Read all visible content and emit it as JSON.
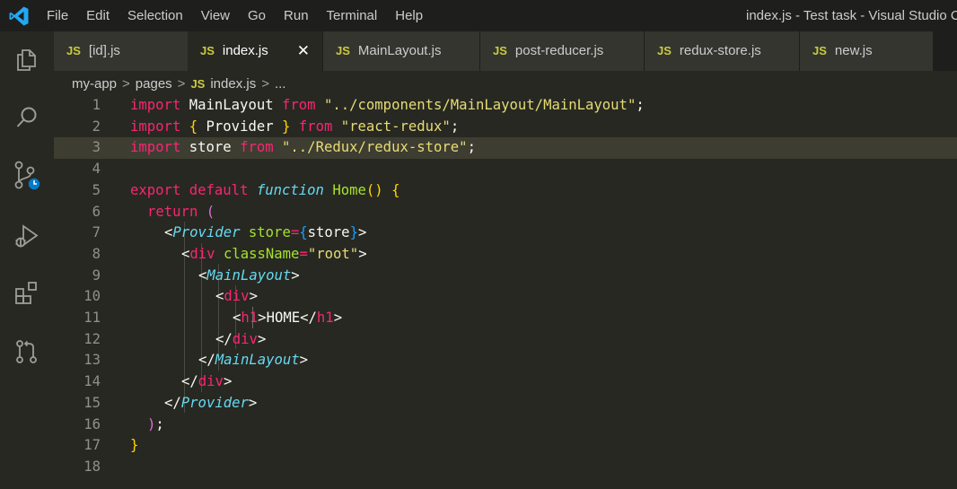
{
  "menu": [
    "File",
    "Edit",
    "Selection",
    "View",
    "Go",
    "Run",
    "Terminal",
    "Help"
  ],
  "window_title": "index.js - Test task - Visual Studio Co",
  "tabs": [
    {
      "icon": "JS",
      "label": "[id].js"
    },
    {
      "icon": "JS",
      "label": "index.js",
      "close": "✕"
    },
    {
      "icon": "JS",
      "label": "MainLayout.js"
    },
    {
      "icon": "JS",
      "label": "post-reducer.js"
    },
    {
      "icon": "JS",
      "label": "redux-store.js"
    },
    {
      "icon": "JS",
      "label": "new.js"
    }
  ],
  "breadcrumb": {
    "root": "my-app",
    "folder": "pages",
    "file_icon": "JS",
    "file": "index.js",
    "more": "...",
    "separator": ">"
  },
  "line_numbers": [
    "1",
    "2",
    "3",
    "4",
    "5",
    "6",
    "7",
    "8",
    "9",
    "10",
    "11",
    "12",
    "13",
    "14",
    "15",
    "16",
    "17",
    "18"
  ],
  "code": {
    "import": "import",
    "from": "from",
    "l1_id": " MainLayout ",
    "l1_path": "\"../components/MainLayout/MainLayout\"",
    "semi": ";",
    "space": " ",
    "brace_open": "{",
    "brace_close": "}",
    "l2_id": " Provider ",
    "l2_path": "\"react-redux\"",
    "l3_id": " store ",
    "l3_path": "\"../Redux/redux-store\"",
    "export": "export",
    "default": "default",
    "function": "function",
    "home": "Home",
    "parens": "()",
    "return": "return",
    "paren_open": "(",
    "paren_close": ")",
    "lt": "<",
    "gt": ">",
    "lt_slash": "</",
    "provider": "Provider",
    "store_attr": "store",
    "eq": "=",
    "store_val": "store",
    "div": "div",
    "classname": "className",
    "root_str": "\"root\"",
    "mainlayout": "MainLayout",
    "h1": "h1",
    "home_text": "HOME"
  },
  "colors": {
    "accent_js": "#cbcb41",
    "keyword": "#f92672",
    "string": "#e6db74",
    "function": "#a6e22e",
    "storage": "#66d9ef",
    "background": "#272822"
  },
  "icons": [
    "vscode-logo-icon",
    "explorer-icon",
    "search-icon",
    "source-control-icon",
    "run-debug-icon",
    "extensions-icon",
    "pull-request-icon"
  ]
}
